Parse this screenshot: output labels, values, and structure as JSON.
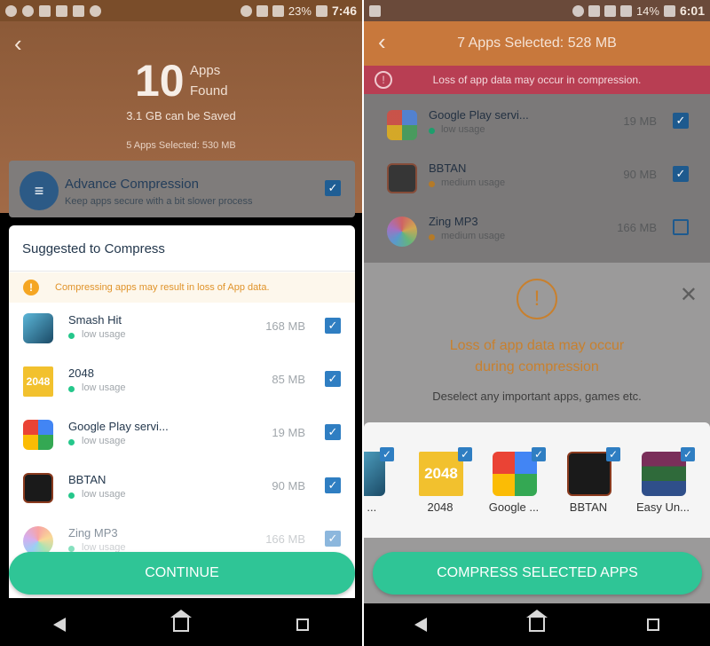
{
  "left": {
    "status": {
      "time": "7:46",
      "battery": "23%"
    },
    "apps_found_count": "10",
    "apps_found_word1": "Apps",
    "apps_found_word2": "Found",
    "can_be_saved": "3.1 GB can be Saved",
    "selected_summary": "5 Apps Selected: 530 MB",
    "advance": {
      "title": "Advance Compression",
      "subtitle": "Keep apps secure with a bit slower process"
    },
    "card_title": "Suggested to Compress",
    "warning": "Compressing apps may result in loss of App data.",
    "apps": [
      {
        "name": "Smash Hit",
        "usage": "low usage",
        "size": "168 MB"
      },
      {
        "name": "2048",
        "usage": "low usage",
        "size": "85 MB"
      },
      {
        "name": "Google Play servi...",
        "usage": "low usage",
        "size": "19 MB"
      },
      {
        "name": "BBTAN",
        "usage": "low usage",
        "size": "90 MB"
      },
      {
        "name": "Zing MP3",
        "usage": "low usage",
        "size": "166 MB"
      }
    ],
    "continue_label": "CONTINUE"
  },
  "right": {
    "status": {
      "time": "6:01",
      "battery": "14%"
    },
    "title": "7 Apps Selected: 528 MB",
    "alert": "Loss of app data may occur in compression.",
    "list": [
      {
        "name": "Google Play servi...",
        "usage": "low usage",
        "size": "19 MB",
        "checked": true
      },
      {
        "name": "BBTAN",
        "usage": "medium usage",
        "size": "90 MB",
        "checked": true
      },
      {
        "name": "Zing MP3",
        "usage": "medium usage",
        "size": "166 MB",
        "checked": false
      }
    ],
    "sheet_title_line1": "Loss of app data may occur",
    "sheet_title_line2": "during compression",
    "sheet_sub": "Deselect any important apps, games etc.",
    "tiles": [
      {
        "label": "...h ..."
      },
      {
        "label": "2048"
      },
      {
        "label": "Google ..."
      },
      {
        "label": "BBTAN"
      },
      {
        "label": "Easy Un..."
      }
    ],
    "compress_label": "COMPRESS SELECTED APPS"
  },
  "colors": {
    "accent": "#2fc596",
    "check": "#2f7ec2",
    "warning": "#e0932a"
  }
}
